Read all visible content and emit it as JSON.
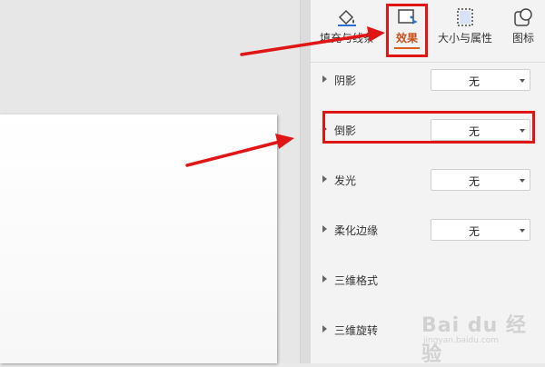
{
  "tabs": {
    "fill_line": "填充与线条",
    "effect": "效果",
    "size_props": "大小与属性",
    "icon": "图标"
  },
  "effects": [
    {
      "label": "阴影",
      "value": "无"
    },
    {
      "label": "倒影",
      "value": "无"
    },
    {
      "label": "发光",
      "value": "无"
    },
    {
      "label": "柔化边缘",
      "value": "无"
    },
    {
      "label": "三维格式"
    },
    {
      "label": "三维旋转"
    }
  ],
  "watermark": {
    "main": "Bai du 经验",
    "sub": "jingyan.baidu.com"
  },
  "colors": {
    "annotation": "#e01515",
    "active_tab": "#c8511b"
  }
}
